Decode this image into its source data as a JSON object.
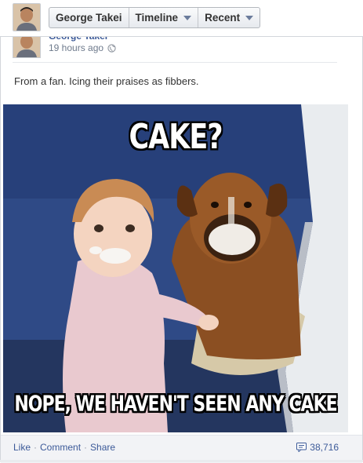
{
  "header": {
    "crumbs": [
      {
        "label": "George Takei",
        "has_caret": false
      },
      {
        "label": "Timeline",
        "has_caret": true
      },
      {
        "label": "Recent",
        "has_caret": true
      }
    ]
  },
  "post": {
    "author": "George Takei",
    "time": "19 hours ago",
    "privacy_icon": "globe-icon",
    "caption": "From a fan. Icing their praises as fibbers.",
    "image": {
      "top_text": "CAKE?",
      "bottom_text": "NOPE, WE HAVEN'T SEEN ANY CAKE"
    },
    "actions": {
      "like": "Like",
      "comment": "Comment",
      "share": "Share",
      "separator": "·"
    },
    "comment_count": "38,716"
  },
  "colors": {
    "link": "#3b5998",
    "footer_bg": "#f2f3f6",
    "meta": "#6e7a8c"
  }
}
